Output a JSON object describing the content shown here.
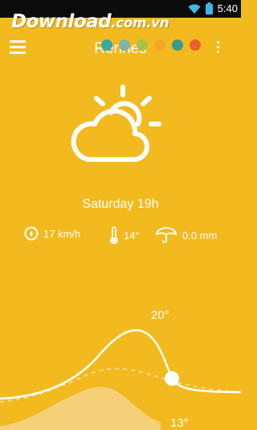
{
  "status_bar": {
    "time": "5:40",
    "icons": [
      "wifi-icon",
      "battery-icon"
    ]
  },
  "watermark": {
    "main": "Download",
    "suffix": ".com.vn"
  },
  "header": {
    "city": "Rennes",
    "color_swatches": [
      "#39A9A8",
      "#7FB3A6",
      "#A7C14F",
      "#F4A62A",
      "#3C9A8C",
      "#E8612A"
    ]
  },
  "current": {
    "condition_icon": "partly-cloudy-icon",
    "date": "Saturday 19h",
    "wind": "17 km/h",
    "temperature": "14°",
    "precipitation": "0.0 mm"
  },
  "forecast_chart": {
    "max_label": "20°",
    "min_label": "13°"
  },
  "colors": {
    "background": "#F2BA1E",
    "foreground": "#FFFFFF",
    "fill": "#F5D078"
  }
}
